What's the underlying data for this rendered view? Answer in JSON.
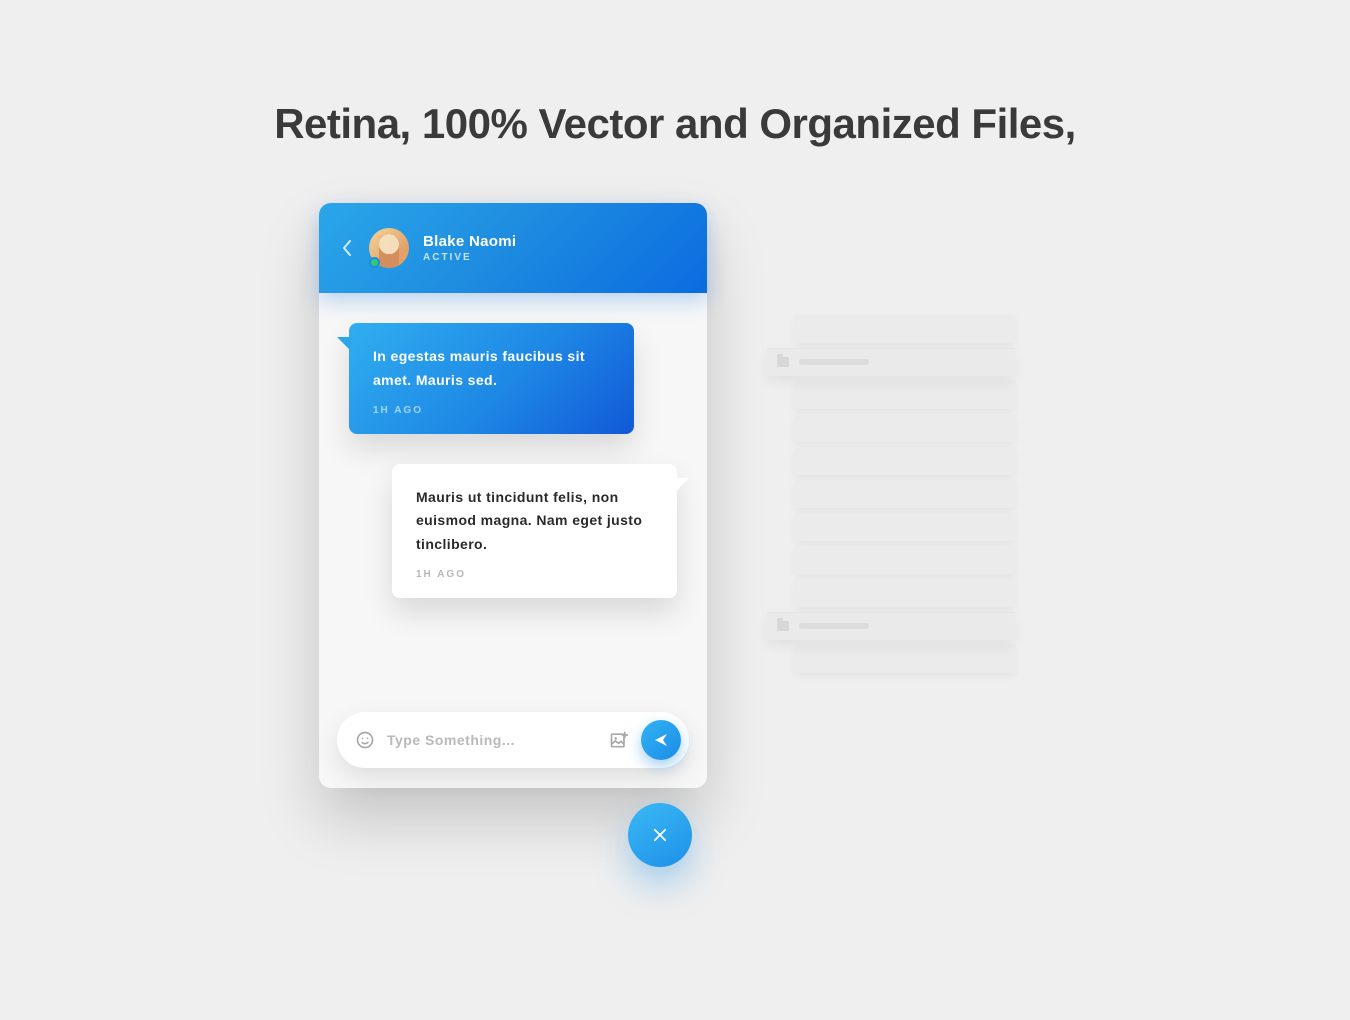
{
  "heading": "Retina, 100% Vector and Organized Files,",
  "chat": {
    "user": {
      "name": "Blake Naomi",
      "status": "ACTIVE"
    },
    "messages": [
      {
        "side": "left",
        "text": "In egestas mauris faucibus sit amet. Mauris sed.",
        "time": "1H AGO"
      },
      {
        "side": "right",
        "text": "Mauris ut tincidunt felis, non euismod magna. Nam eget justo tinclibero.",
        "time": "1H AGO"
      }
    ],
    "composer": {
      "placeholder": "Type Something..."
    }
  },
  "colors": {
    "gradient_start": "#30aef0",
    "gradient_end": "#1159d7",
    "active_dot": "#2ecc71"
  }
}
